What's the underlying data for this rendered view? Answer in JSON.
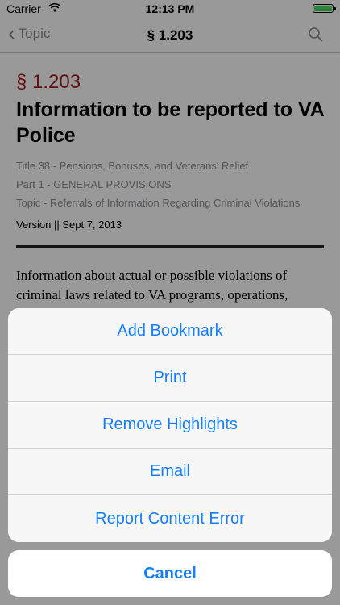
{
  "status_bar": {
    "carrier": "Carrier",
    "time": "12:13 PM",
    "battery_level": 1.0
  },
  "nav": {
    "back_label": "Topic",
    "title": "§ 1.203"
  },
  "document": {
    "section_number": "§ 1.203",
    "title": "Information to be reported to VA Police",
    "meta": [
      "Title 38 - Pensions, Bonuses, and Veterans' Relief",
      "Part 1 - GENERAL PROVISIONS",
      "Topic - Referrals of Information Regarding Criminal Violations"
    ],
    "version": "Version || Sept 7, 2013",
    "body": "Information about actual or possible violations of criminal laws related to VA programs, operations, facilities, or involving VA employees, where the"
  },
  "action_sheet": {
    "items": [
      "Add Bookmark",
      "Print",
      "Remove Highlights",
      "Email",
      "Report Content Error"
    ],
    "cancel": "Cancel"
  },
  "colors": {
    "accent": "#147efb",
    "section_red": "#a31b1b",
    "battery": "#4cd964"
  }
}
